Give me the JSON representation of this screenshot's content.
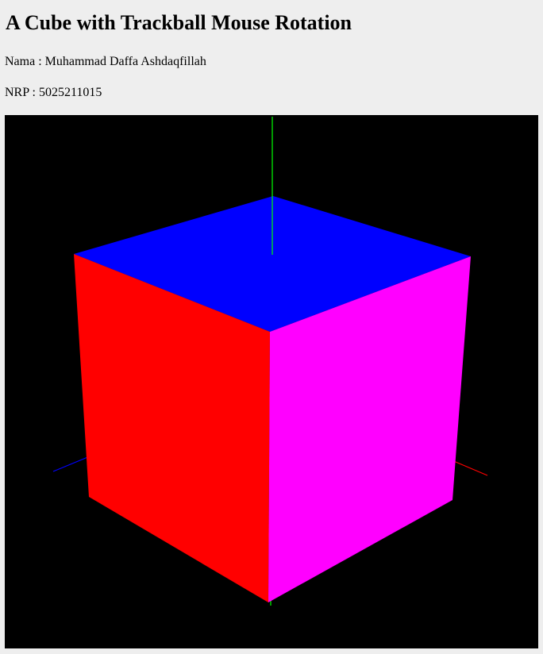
{
  "page": {
    "title": "A Cube with Trackball Mouse Rotation",
    "name_line": "Nama : Muhammad Daffa Ashdaqfillah",
    "nrp_line": "NRP : 5025211015"
  },
  "scene": {
    "background_color": "#000000",
    "faces": {
      "top": {
        "color": "#0000ff"
      },
      "left": {
        "color": "#ff0000"
      },
      "right": {
        "color": "#ff00ff"
      }
    },
    "axes": {
      "y": {
        "color": "#00ff00"
      },
      "x": {
        "color": "#ff0000"
      },
      "z": {
        "color": "#0000ff"
      }
    }
  }
}
